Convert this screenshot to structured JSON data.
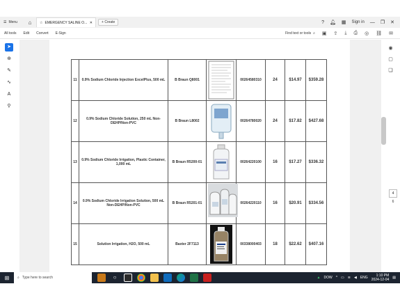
{
  "browser": {
    "menu_label": "Menu",
    "tab_title": "EMERGENCY SALINE O...",
    "create_label": "Create",
    "signin_label": "Sign in"
  },
  "toolbar": {
    "all_tools": "All tools",
    "edit": "Edit",
    "convert": "Convert",
    "esign": "E-Sign",
    "find_placeholder": "Find text or tools"
  },
  "document": {
    "rows": [
      {
        "num": "11",
        "desc": "0.9% Sodium Chloride Injection ExcelPlus, 500 mL",
        "vendor": "B Braun Q8001",
        "image": "document-thumbnail",
        "code": "00264580310",
        "qty": "24",
        "unit": "$14.97",
        "total": "$359.28"
      },
      {
        "num": "12",
        "desc": "0.9% Sodium Chloride Solution, 250 mL Non-DEHP/Non-PVC",
        "vendor": "B Braun L8002",
        "image": "iv-bag",
        "code": "00264780020",
        "qty": "24",
        "unit": "$17.82",
        "total": "$427.68"
      },
      {
        "num": "13",
        "desc": "0.9% Sodium Chloride Irrigation, Plastic Container, 1,000 mL",
        "vendor": "B Braun R5200-01",
        "image": "plastic-bottle",
        "code": "00264220100",
        "qty": "16",
        "unit": "$17.27",
        "total": "$336.32"
      },
      {
        "num": "14",
        "desc": "0.9% Sodium Chloride Irrigation Solution, 500 mL Non-DEHP/Non-PVC",
        "vendor": "B Braun R5201-01",
        "image": "bottle-group",
        "code": "00264220110",
        "qty": "16",
        "unit": "$20.91",
        "total": "$334.56"
      },
      {
        "num": "15",
        "desc": "Solution Irrigation, H2O, 500 mL",
        "vendor": "Baxter 2F7113",
        "image": "irrigation-bottle",
        "code": "00338000403",
        "qty": "18",
        "unit": "$22.62",
        "total": "$407.16"
      }
    ]
  },
  "pager": {
    "current": "4",
    "total": "6"
  },
  "taskbar": {
    "search_placeholder": "Type here to search",
    "dow_label": "DOW",
    "lang": "ENG",
    "time": "1:10 PM",
    "date": "2024-12-04"
  },
  "colors": {
    "accent": "#1a73e8",
    "taskbar": "#1c2430"
  }
}
